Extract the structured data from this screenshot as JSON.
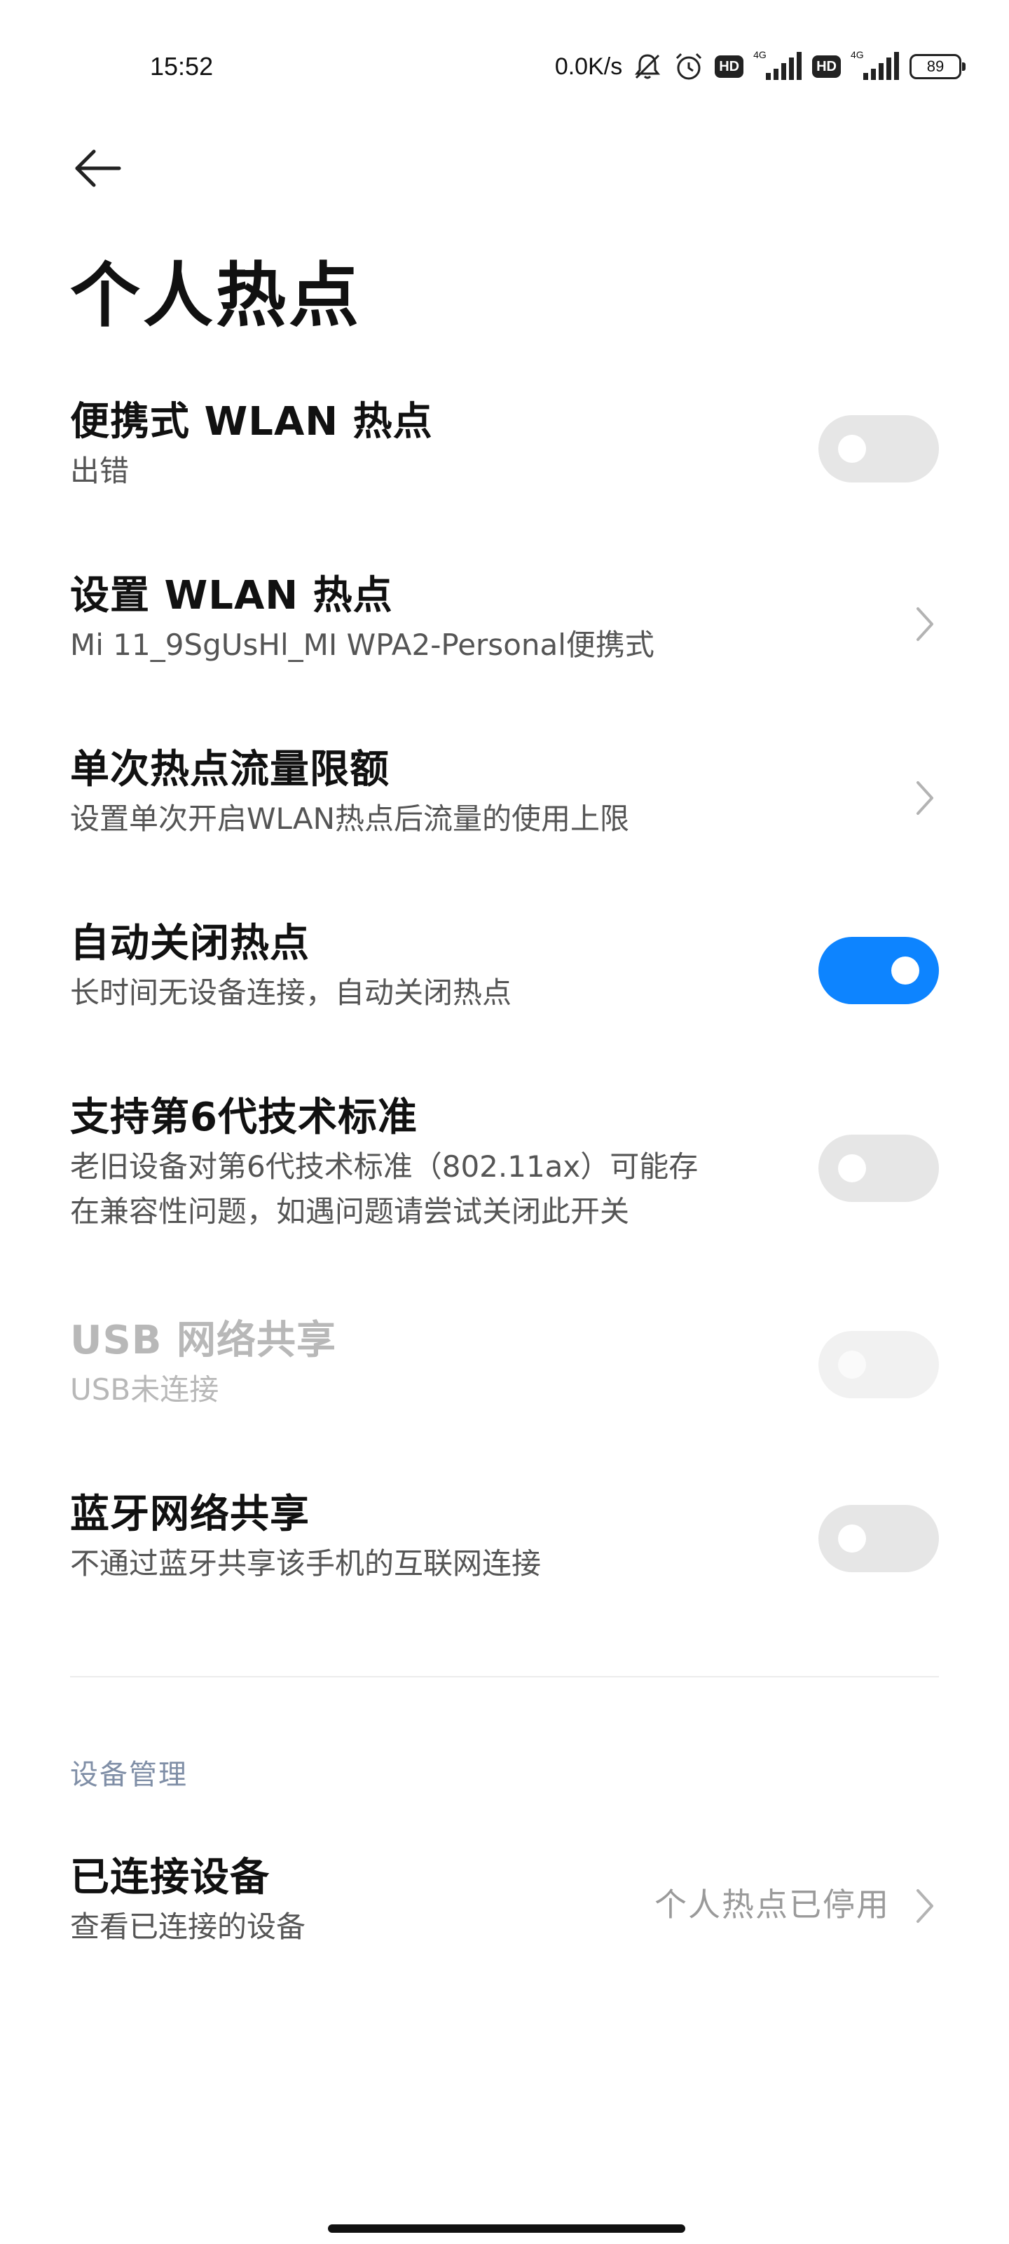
{
  "status_bar": {
    "time": "15:52",
    "net_speed": "0.0K/s",
    "hd1": "HD",
    "hd2": "HD",
    "lte1": "4G",
    "lte2": "4G",
    "battery": "89"
  },
  "page": {
    "title": "个人热点"
  },
  "rows": {
    "portable_hotspot": {
      "title": "便携式 WLAN 热点",
      "subtitle": "出错",
      "toggle_on": false
    },
    "setup_hotspot": {
      "title": "设置 WLAN 热点",
      "subtitle": "Mi 11_9SgUsHl_MI WPA2-Personal便携式"
    },
    "data_limit": {
      "title": "单次热点流量限额",
      "subtitle": "设置单次开启WLAN热点后流量的使用上限"
    },
    "auto_close": {
      "title": "自动关闭热点",
      "subtitle": "长时间无设备连接，自动关闭热点",
      "toggle_on": true
    },
    "wifi6": {
      "title": "支持第6代技术标准",
      "subtitle_line1": "老旧设备对第6代技术标准（802.11ax）可能存",
      "subtitle_line2": "在兼容性问题，如遇问题请尝试关闭此开关",
      "toggle_on": false
    },
    "usb_tethering": {
      "title": "USB 网络共享",
      "subtitle": "USB未连接",
      "toggle_on": false,
      "disabled": true
    },
    "bt_tethering": {
      "title": "蓝牙网络共享",
      "subtitle": "不通过蓝牙共享该手机的互联网连接",
      "toggle_on": false
    }
  },
  "device_section": {
    "header": "设备管理",
    "connected_devices": {
      "title": "已连接设备",
      "subtitle": "查看已连接的设备",
      "value": "个人热点已停用"
    }
  },
  "colors": {
    "accent": "#0d84ff",
    "toggle_off": "#e6e6e6",
    "section_header": "#7f8ea6"
  }
}
